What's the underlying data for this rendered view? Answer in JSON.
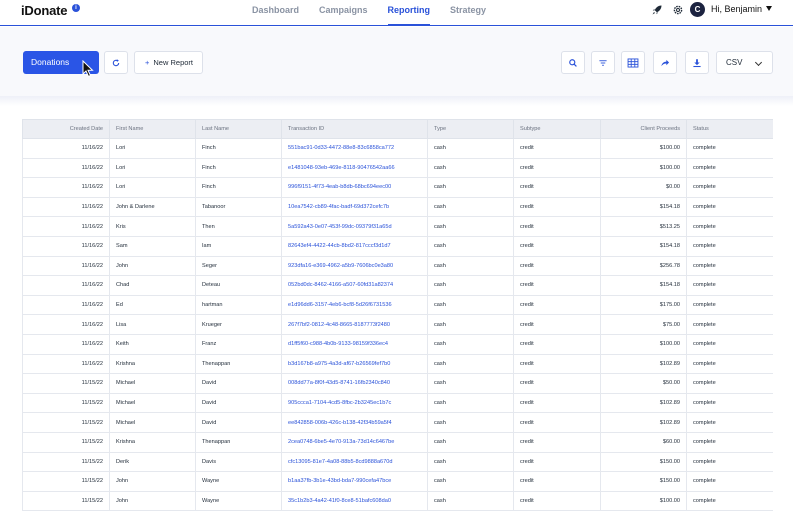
{
  "header": {
    "logo": "iDonate",
    "info_badge": "i",
    "tabs": [
      {
        "label": "Dashboard",
        "active": false
      },
      {
        "label": "Campaigns",
        "active": false
      },
      {
        "label": "Reporting",
        "active": true
      },
      {
        "label": "Strategy",
        "active": false
      }
    ],
    "avatar_initial": "C",
    "greeting": "Hi, Benjamin",
    "icons": [
      "rocket-icon",
      "gear-icon",
      "chevron-down-icon"
    ]
  },
  "toolbar": {
    "report_button": "Donations",
    "new_report_plus": "+",
    "new_report_label": "New Report",
    "export_format": "CSV",
    "icons": [
      "refresh-icon",
      "search-icon",
      "filter-icon",
      "columns-icon",
      "share-icon",
      "download-icon"
    ]
  },
  "colors": {
    "accent": "#2a52d9",
    "primary_button": "#2a55e6",
    "header_bg": "#eceef3",
    "avatar_bg": "#1c2340"
  },
  "table": {
    "columns": [
      "Created Date",
      "First Name",
      "Last Name",
      "Transaction ID",
      "Type",
      "Subtype",
      "Client Proceeds",
      "Status"
    ],
    "rows": [
      [
        "11/16/22",
        "Lori",
        "Finch",
        "551bac91-0d33-4472-88e8-83c6858ca772",
        "cash",
        "credit",
        "$100.00",
        "complete"
      ],
      [
        "11/16/22",
        "Lori",
        "Finch",
        "e1481048-93eb-469e-8118-90476542aa66",
        "cash",
        "credit",
        "$100.00",
        "complete"
      ],
      [
        "11/16/22",
        "Lori",
        "Finch",
        "996f9151-4f73-4eab-b8db-68bc694eec00",
        "cash",
        "credit",
        "$0.00",
        "complete"
      ],
      [
        "11/16/22",
        "John & Darlene",
        "Tabanoor",
        "10ea7542-cb89-4fac-badf-69d372cefc7b",
        "cash",
        "credit",
        "$154.18",
        "complete"
      ],
      [
        "11/16/22",
        "Kris",
        "Then",
        "5a592a43-0e07-453f-99dc-09379f31a65d",
        "cash",
        "credit",
        "$513.25",
        "complete"
      ],
      [
        "11/16/22",
        "Sam",
        "Iam",
        "82643ef4-4422-44cb-8bd2-817cccf3d1d7",
        "cash",
        "credit",
        "$154.18",
        "complete"
      ],
      [
        "11/16/22",
        "John",
        "Seger",
        "923dfa16-e369-4962-a5b9-7606bc0e3a80",
        "cash",
        "credit",
        "$256.78",
        "complete"
      ],
      [
        "11/16/22",
        "Chad",
        "Deteau",
        "052bd0dc-8462-4166-a507-60fd31a82374",
        "cash",
        "credit",
        "$154.18",
        "complete"
      ],
      [
        "11/16/22",
        "Ed",
        "hartman",
        "e1d96dd6-3157-4eb6-bcf8-5d26f6731536",
        "cash",
        "credit",
        "$175.00",
        "complete"
      ],
      [
        "11/16/22",
        "Lisa",
        "Krueger",
        "267f7bf2-0812-4c48-8665-8187773f2480",
        "cash",
        "credit",
        "$75.00",
        "complete"
      ],
      [
        "11/16/22",
        "Keith",
        "Franz",
        "d1ff5f60-c988-4b0b-9133-98159f336ec4",
        "cash",
        "credit",
        "$100.00",
        "complete"
      ],
      [
        "11/16/22",
        "Krishna",
        "Thenappan",
        "b3d167b8-a975-4a3d-af67-b26569fef7b0",
        "cash",
        "credit",
        "$102.89",
        "complete"
      ],
      [
        "11/15/22",
        "Michael",
        "David",
        "008dd77a-8f0f-43d5-8741-16fb2340c840",
        "cash",
        "credit",
        "$50.00",
        "complete"
      ],
      [
        "11/15/22",
        "Michael",
        "David",
        "905ccca1-7104-4cd5-8fbc-2b3245ec1b7c",
        "cash",
        "credit",
        "$102.89",
        "complete"
      ],
      [
        "11/15/22",
        "Michael",
        "David",
        "ee842858-006b-426c-b138-42f34b59a5f4",
        "cash",
        "credit",
        "$102.89",
        "complete"
      ],
      [
        "11/15/22",
        "Krishna",
        "Thenappan",
        "2cea0748-6be5-4e70-913a-73d14c6467be",
        "cash",
        "credit",
        "$60.00",
        "complete"
      ],
      [
        "11/15/22",
        "Derik",
        "Davis",
        "cfc13095-81e7-4a08-88b5-8cd9888a670d",
        "cash",
        "credit",
        "$150.00",
        "complete"
      ],
      [
        "11/15/22",
        "John",
        "Wayne",
        "b1aa37fb-3b1e-43bd-bda7-990cefa47bce",
        "cash",
        "credit",
        "$150.00",
        "complete"
      ],
      [
        "11/15/22",
        "John",
        "Wayne",
        "35c1b2b3-4a42-41f0-8ce8-51bafc608da0",
        "cash",
        "credit",
        "$100.00",
        "complete"
      ]
    ]
  }
}
